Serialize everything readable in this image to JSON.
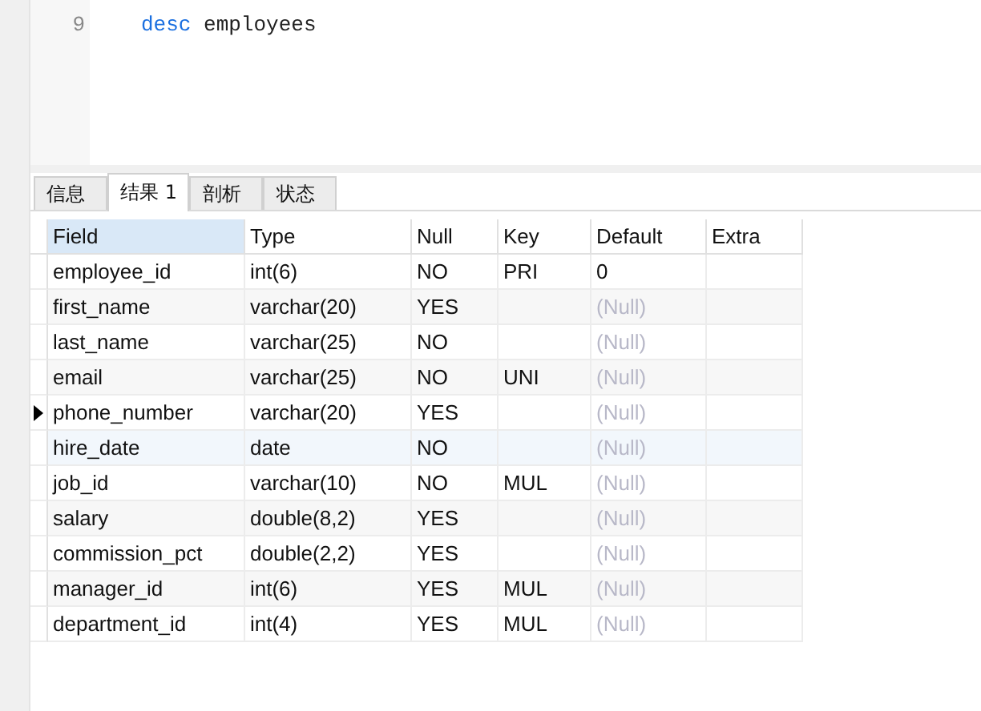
{
  "editor": {
    "lines": [
      {
        "number": "9",
        "tokens": [
          {
            "text": "desc",
            "kind": "keyword"
          },
          {
            "text": "employees",
            "kind": "plain"
          }
        ]
      }
    ]
  },
  "tabs": [
    {
      "label": "信息",
      "selected": false
    },
    {
      "label": "结果 1",
      "selected": true
    },
    {
      "label": "剖析",
      "selected": false
    },
    {
      "label": "状态",
      "selected": false
    }
  ],
  "table": {
    "columns": [
      {
        "label": "Field",
        "selected": true
      },
      {
        "label": "Type",
        "selected": false
      },
      {
        "label": "Null",
        "selected": false
      },
      {
        "label": "Key",
        "selected": false
      },
      {
        "label": "Default",
        "selected": false
      },
      {
        "label": "Extra",
        "selected": false
      }
    ],
    "rows": [
      {
        "field": "employee_id",
        "type": "int(6)",
        "null": "NO",
        "key": "PRI",
        "default": {
          "text": "0",
          "is_null": false
        },
        "current": false,
        "highlighted": false
      },
      {
        "field": "first_name",
        "type": "varchar(20)",
        "null": "YES",
        "key": "",
        "default": {
          "text": "(Null)",
          "is_null": true
        },
        "current": false,
        "highlighted": false
      },
      {
        "field": "last_name",
        "type": "varchar(25)",
        "null": "NO",
        "key": "",
        "default": {
          "text": "(Null)",
          "is_null": true
        },
        "current": false,
        "highlighted": false
      },
      {
        "field": "email",
        "type": "varchar(25)",
        "null": "NO",
        "key": "UNI",
        "default": {
          "text": "(Null)",
          "is_null": true
        },
        "current": false,
        "highlighted": false
      },
      {
        "field": "phone_number",
        "type": "varchar(20)",
        "null": "YES",
        "key": "",
        "default": {
          "text": "(Null)",
          "is_null": true
        },
        "current": true,
        "highlighted": false
      },
      {
        "field": "hire_date",
        "type": "date",
        "null": "NO",
        "key": "",
        "default": {
          "text": "(Null)",
          "is_null": true
        },
        "current": false,
        "highlighted": true
      },
      {
        "field": "job_id",
        "type": "varchar(10)",
        "null": "NO",
        "key": "MUL",
        "default": {
          "text": "(Null)",
          "is_null": true
        },
        "current": false,
        "highlighted": false
      },
      {
        "field": "salary",
        "type": "double(8,2)",
        "null": "YES",
        "key": "",
        "default": {
          "text": "(Null)",
          "is_null": true
        },
        "current": false,
        "highlighted": false
      },
      {
        "field": "commission_pct",
        "type": "double(2,2)",
        "null": "YES",
        "key": "",
        "default": {
          "text": "(Null)",
          "is_null": true
        },
        "current": false,
        "highlighted": false
      },
      {
        "field": "manager_id",
        "type": "int(6)",
        "null": "YES",
        "key": "MUL",
        "default": {
          "text": "(Null)",
          "is_null": true
        },
        "current": false,
        "highlighted": false
      },
      {
        "field": "department_id",
        "type": "int(4)",
        "null": "YES",
        "key": "MUL",
        "default": {
          "text": "(Null)",
          "is_null": true
        },
        "current": false,
        "highlighted": false
      }
    ]
  }
}
